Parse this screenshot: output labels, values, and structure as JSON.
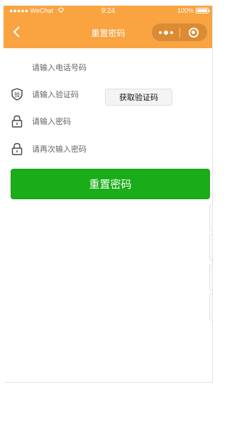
{
  "status_bar": {
    "carrier": "●●●●● WeChat",
    "wifi_icon": "wifi-icon",
    "time": "9:24",
    "battery": "100%"
  },
  "nav": {
    "title": "重置密码",
    "back_icon": "chevron-left-icon",
    "more_icon": "more-dots-icon",
    "close_icon": "target-close-icon"
  },
  "form": {
    "phone": {
      "placeholder": "请输入电话号码",
      "icon": ""
    },
    "code": {
      "placeholder": "请输入验证码",
      "icon": "shield-code-icon",
      "icon_text": "验",
      "button_label": "获取验证码"
    },
    "password": {
      "placeholder": "请输入密码",
      "icon": "lock-icon"
    },
    "confirm_password": {
      "placeholder": "请再次输入密码",
      "icon": "lock-icon"
    }
  },
  "submit": {
    "label": "重置密码"
  },
  "colors": {
    "accent_orange": "#f9a341",
    "primary_green": "#1aad19",
    "text_gray": "#666666"
  }
}
